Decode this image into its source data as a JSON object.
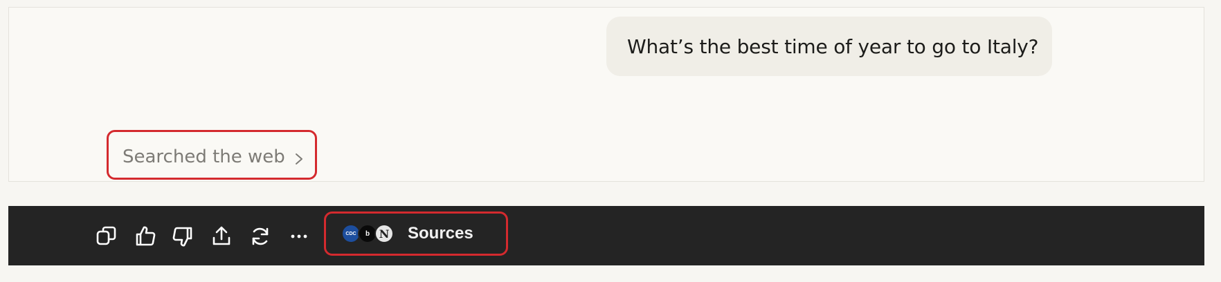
{
  "conversation": {
    "user_message": "What’s the best time of year to go to Italy?",
    "search_status": "Searched the web"
  },
  "toolbar": {
    "icons": [
      "copy-icon",
      "thumbs-up-icon",
      "thumbs-down-icon",
      "share-icon",
      "retry-icon",
      "more-icon"
    ],
    "sources_label": "Sources",
    "source_favicons": [
      {
        "name": "cdc-favicon",
        "text": "CDC"
      },
      {
        "name": "bk-favicon",
        "text": "b"
      },
      {
        "name": "n-favicon",
        "text": "N"
      }
    ]
  },
  "colors": {
    "highlight": "#d42a2e",
    "toolbar_bg": "#242424",
    "bubble_bg": "#f0eee7"
  }
}
